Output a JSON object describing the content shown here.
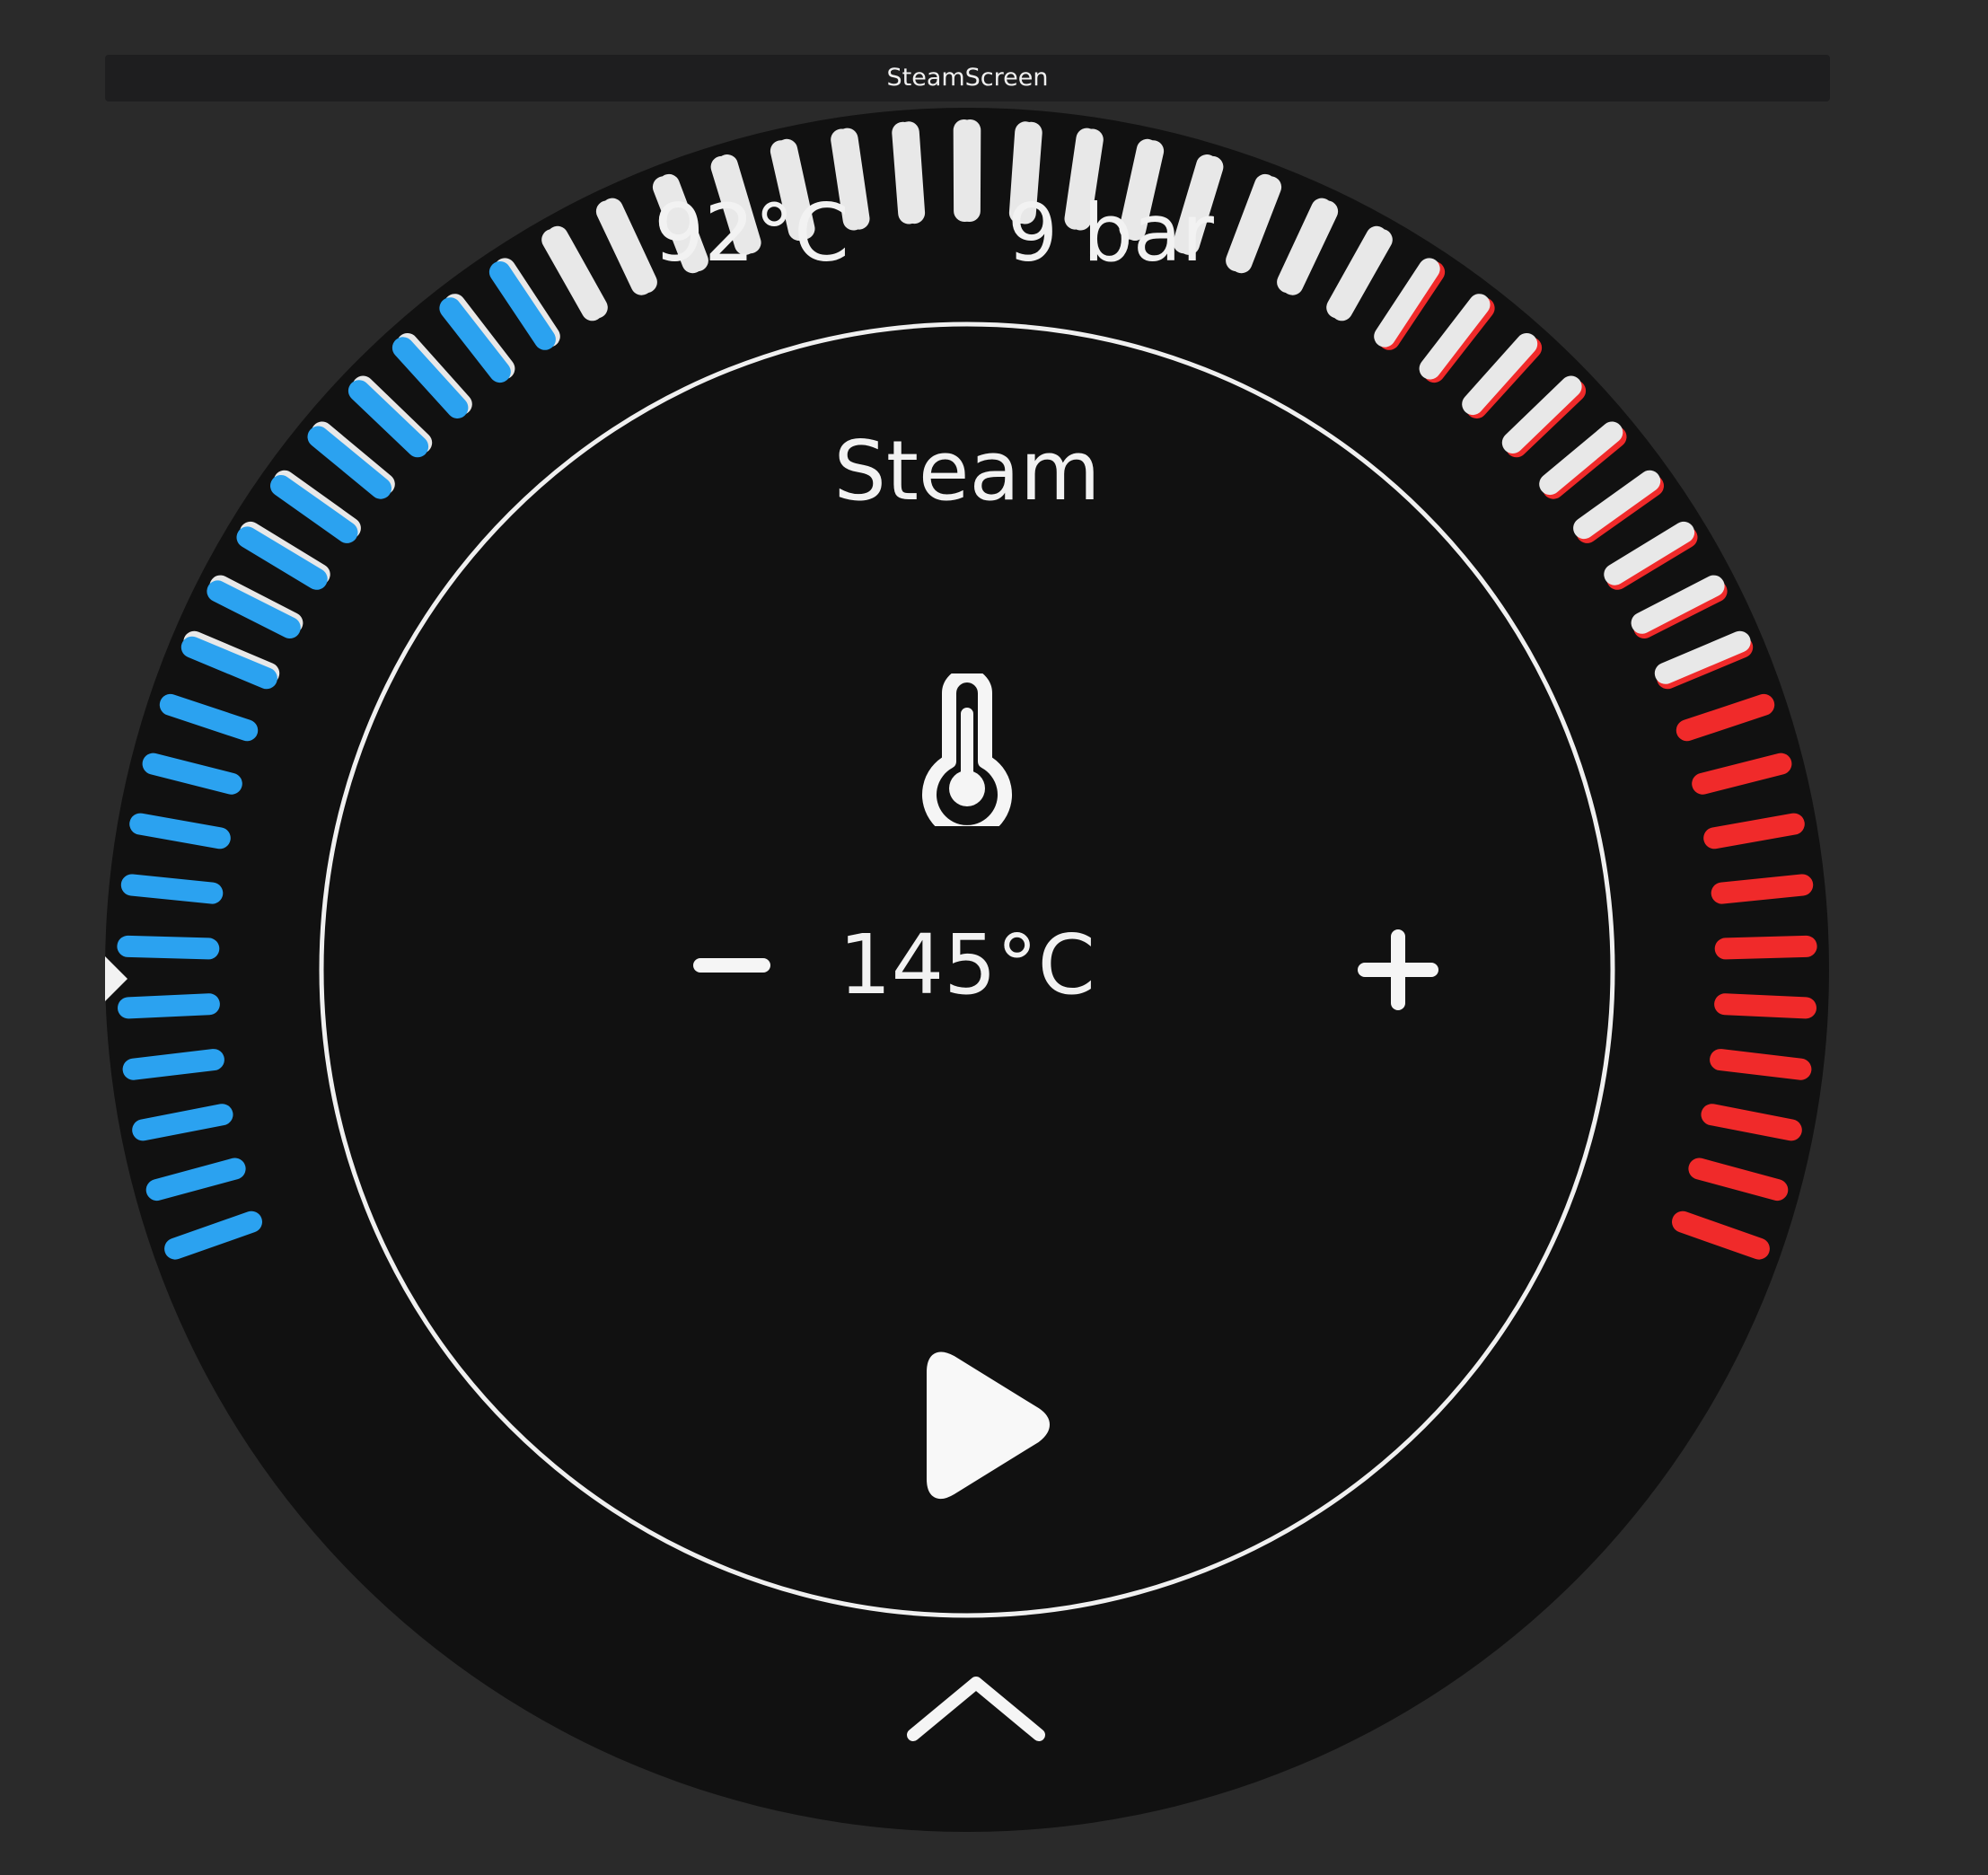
{
  "window": {
    "title": "SteamScreen"
  },
  "status": {
    "brew_temperature": "92°C",
    "pressure": "9 bar"
  },
  "mode": {
    "title": "Steam"
  },
  "setpoint": {
    "value": "145°C"
  },
  "gauges": {
    "temperature_color": "#f02a2a",
    "pressure_color": "#2ba2f0",
    "inactive_color": "#e8e8e8",
    "temperature_fill": 0.45,
    "pressure_fill": 0.45
  },
  "icons": {
    "thermometer": "thermometer-icon",
    "minus": "minus-icon",
    "plus": "plus-icon",
    "play": "play-icon",
    "chevron": "chevron-up-icon"
  }
}
